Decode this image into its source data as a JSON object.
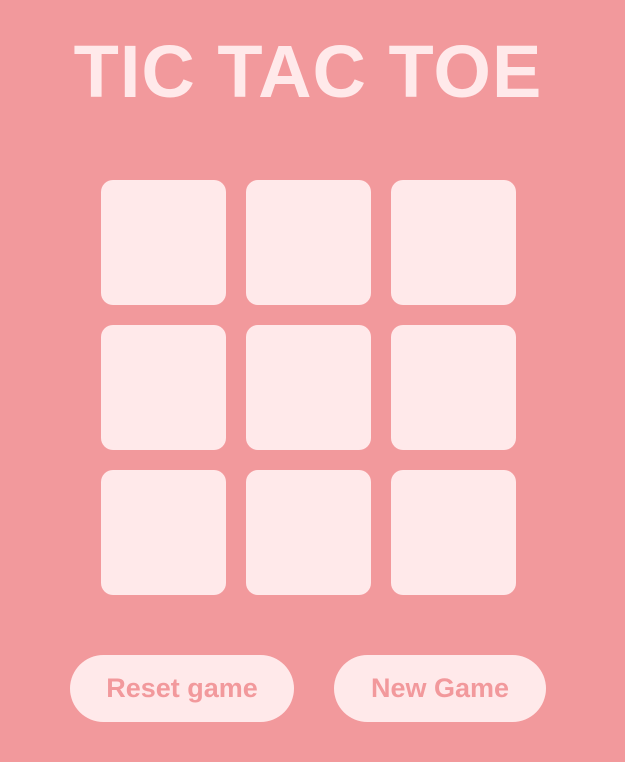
{
  "header": {
    "title": "TIC TAC TOE"
  },
  "board": {
    "cells": [
      "",
      "",
      "",
      "",
      "",
      "",
      "",
      "",
      ""
    ]
  },
  "controls": {
    "reset_label": "Reset game",
    "new_game_label": "New Game"
  },
  "colors": {
    "background": "#f2999c",
    "tile": "#ffe9ea",
    "accent_text": "#f2999c"
  }
}
